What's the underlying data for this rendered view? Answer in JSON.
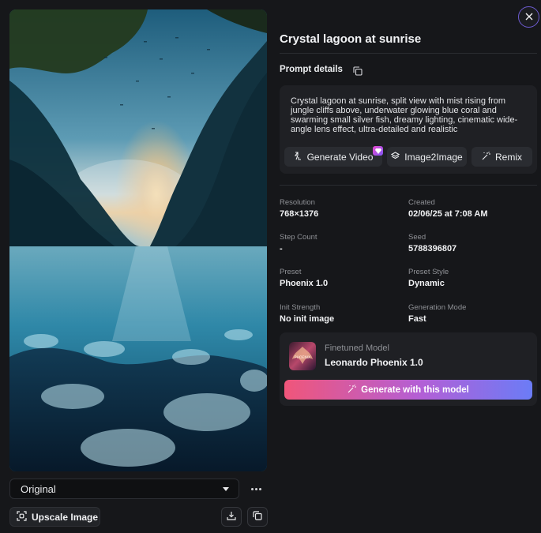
{
  "image_panel": {
    "variant_select": {
      "selected": "Original"
    },
    "more_icon": "more-horizontal-icon",
    "upscale_label": "Upscale Image",
    "download_icon": "download-icon",
    "copy_icon": "copy-icon"
  },
  "details": {
    "title": "Crystal lagoon at sunrise",
    "prompt_label": "Prompt details",
    "prompt_text": "Crystal lagoon at sunrise, split view with mist rising from jungle cliffs above, underwater glowing blue coral and swarming small silver fish, dreamy lighting, cinematic wide-angle lens effect, ultra-detailed and realistic",
    "actions": {
      "generate_video": "Generate Video",
      "image2image": "Image2Image",
      "remix": "Remix"
    },
    "metadata": [
      {
        "label": "Resolution",
        "value": "768×1376"
      },
      {
        "label": "Created",
        "value": "02/06/25 at 7:08 AM"
      },
      {
        "label": "Step Count",
        "value": "-"
      },
      {
        "label": "Seed",
        "value": "5788396807"
      },
      {
        "label": "Preset",
        "value": "Phoenix 1.0"
      },
      {
        "label": "Preset Style",
        "value": "Dynamic"
      },
      {
        "label": "Init Strength",
        "value": "No init image"
      },
      {
        "label": "Generation Mode",
        "value": "Fast"
      }
    ],
    "model": {
      "kind_label": "Finetuned Model",
      "name": "Leonardo Phoenix 1.0",
      "thumb_text": "PHOENIX",
      "generate_label": "Generate with this model"
    }
  },
  "colors": {
    "background": "#16171a",
    "card": "#1f2024",
    "close_ring": "#6d5bd0",
    "cta_gradient": [
      "#f0567a",
      "#b35fd6",
      "#6b7cf6"
    ]
  }
}
